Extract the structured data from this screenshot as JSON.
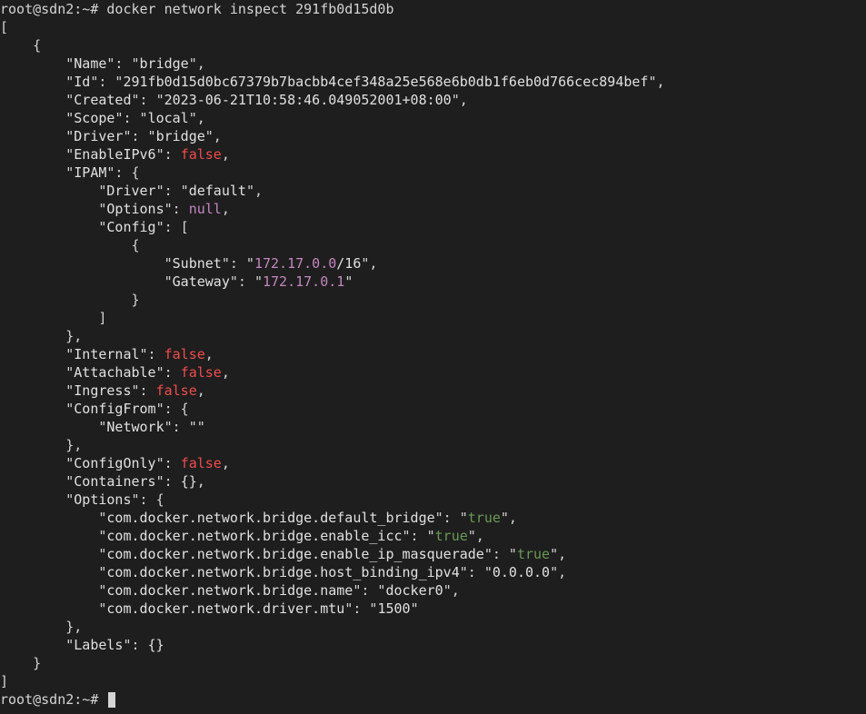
{
  "prompt": {
    "host_line_partial": "root@sdn2:~#",
    "command": "docker network inspect 291fb0d15d0b"
  },
  "network": {
    "Name": "bridge",
    "Id": "291fb0d15d0bc67379b7bacbb4cef348a25e568e6b0db1f6eb0d766cec894bef",
    "Created": "2023-06-21T10:58:46.049052001+08:00",
    "Scope": "local",
    "Driver": "bridge",
    "EnableIPv6": "false",
    "IPAM": {
      "Driver": "default",
      "Options": "null",
      "Config": {
        "Subnet": "172.17.0.0",
        "SubnetSuffix": "/16",
        "Gateway": "172.17.0.1"
      }
    },
    "Internal": "false",
    "Attachable": "false",
    "Ingress": "false",
    "ConfigFrom": {
      "Network": ""
    },
    "ConfigOnly": "false",
    "Containers": "{}",
    "Options": {
      "com.docker.network.bridge.default_bridge": "true",
      "com.docker.network.bridge.enable_icc": "true",
      "com.docker.network.bridge.enable_ip_masquerade": "true",
      "com.docker.network.bridge.host_binding_ipv4": "0.0.0.0",
      "com.docker.network.bridge.name": "docker0",
      "com.docker.network.driver.mtu": "1500"
    },
    "Labels": "{}"
  },
  "keys": {
    "Name": "Name",
    "Id": "Id",
    "Created": "Created",
    "Scope": "Scope",
    "Driver": "Driver",
    "EnableIPv6": "EnableIPv6",
    "IPAM": "IPAM",
    "IPAM_Driver": "Driver",
    "IPAM_Options": "Options",
    "IPAM_Config": "Config",
    "Subnet": "Subnet",
    "Gateway": "Gateway",
    "Internal": "Internal",
    "Attachable": "Attachable",
    "Ingress": "Ingress",
    "ConfigFrom": "ConfigFrom",
    "ConfigFrom_Network": "Network",
    "ConfigOnly": "ConfigOnly",
    "Containers": "Containers",
    "Options": "Options",
    "opt1": "com.docker.network.bridge.default_bridge",
    "opt2": "com.docker.network.bridge.enable_icc",
    "opt3": "com.docker.network.bridge.enable_ip_masquerade",
    "opt4": "com.docker.network.bridge.host_binding_ipv4",
    "opt5": "com.docker.network.bridge.name",
    "opt6": "com.docker.network.driver.mtu",
    "Labels": "Labels"
  }
}
